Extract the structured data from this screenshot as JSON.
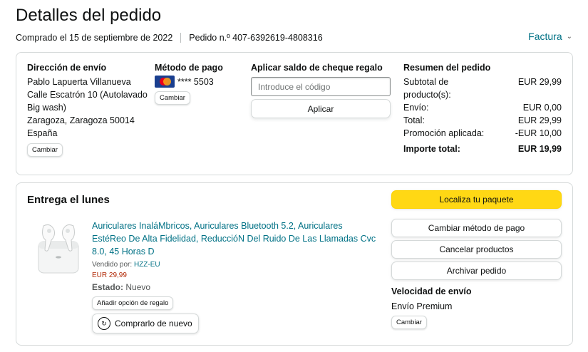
{
  "header": {
    "title": "Detalles del pedido",
    "purchased": "Comprado el 15 de septiembre de 2022",
    "order_number": "Pedido n.º 407-6392619-4808316",
    "invoice_label": "Factura"
  },
  "shipping": {
    "title": "Dirección de envío",
    "lines": [
      "Pablo Lapuerta Villanueva",
      "Calle Escatrón 10 (Autolavado Big wash)",
      "Zaragoza, Zaragoza 50014",
      "España"
    ],
    "change_label": "Cambiar"
  },
  "payment": {
    "title": "Método de pago",
    "card_masked": "**** 5503",
    "card_icon": "mastercard-icon",
    "change_label": "Cambiar"
  },
  "gift_card": {
    "title": "Aplicar saldo de cheque regalo",
    "placeholder": "Introduce el código",
    "apply_label": "Aplicar"
  },
  "summary": {
    "title": "Resumen del pedido",
    "rows": [
      {
        "label": "Subtotal de producto(s):",
        "value": "EUR 29,99"
      },
      {
        "label": "Envío:",
        "value": "EUR 0,00"
      },
      {
        "label": "Total:",
        "value": "EUR 29,99"
      },
      {
        "label": "Promoción aplicada:",
        "value": "-EUR 10,00"
      }
    ],
    "grand_total_label": "Importe total:",
    "grand_total_value": "EUR 19,99"
  },
  "delivery": {
    "title": "Entrega el lunes",
    "product": {
      "name": "Auriculares InaláMbricos, Auriculares Bluetooth 5.2, Auriculares EstéReo De Alta Fidelidad, ReduccióN Del Ruido De Las Llamadas Cvc 8.0, 45 Horas D",
      "seller_prefix": "Vendido por: ",
      "seller": "HZZ-EU",
      "price": "EUR 29,99",
      "status_label": "Estado:",
      "status_value": "Nuevo",
      "gift_option_label": "Añadir opción de regalo",
      "rebuy_label": "Comprarlo de nuevo"
    },
    "actions": {
      "track": "Localiza tu paquete",
      "change_payment": "Cambiar método de pago",
      "cancel": "Cancelar productos",
      "archive": "Archivar pedido"
    },
    "speed_title": "Velocidad de envío",
    "speed_value": "Envío Premium",
    "speed_change": "Cambiar"
  },
  "colors": {
    "link": "#007185",
    "primary_button": "#ffd814",
    "price": "#b12704"
  }
}
